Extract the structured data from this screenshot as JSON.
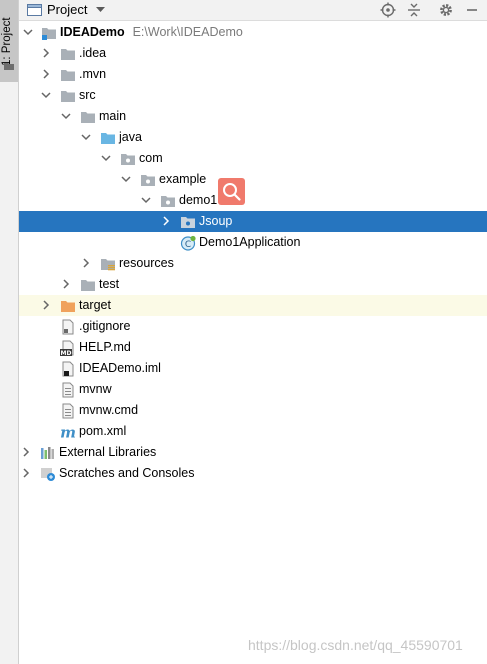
{
  "stripe": {
    "label": "1: Project"
  },
  "header": {
    "title": "Project"
  },
  "tree": {
    "root": {
      "label": "IDEADemo",
      "path": "E:\\Work\\IDEADemo"
    },
    "idea": ".idea",
    "mvn": ".mvn",
    "src": "src",
    "main": "main",
    "java": "java",
    "com": "com",
    "example": "example",
    "demo1": "demo1",
    "jsoup": "Jsoup",
    "app": "Demo1Application",
    "resources": "resources",
    "test": "test",
    "target": "target",
    "gitignore": ".gitignore",
    "help": "HELP.md",
    "iml": "IDEADemo.iml",
    "mvnw": "mvnw",
    "mvnwcmd": "mvnw.cmd",
    "pom": "pom.xml",
    "extlibs": "External Libraries",
    "scratches": "Scratches and Consoles"
  },
  "icons": {
    "md_badge": "MD",
    "maven_glyph": "m"
  },
  "colors": {
    "selection": "#2675bf",
    "highlight": "#fbfae6",
    "folder": "#a9b0b7",
    "source_folder": "#69b6e3",
    "target_folder": "#f0a25c",
    "search_badge": "#f07a6c"
  },
  "watermark": "https://blog.csdn.net/qq_45590701"
}
